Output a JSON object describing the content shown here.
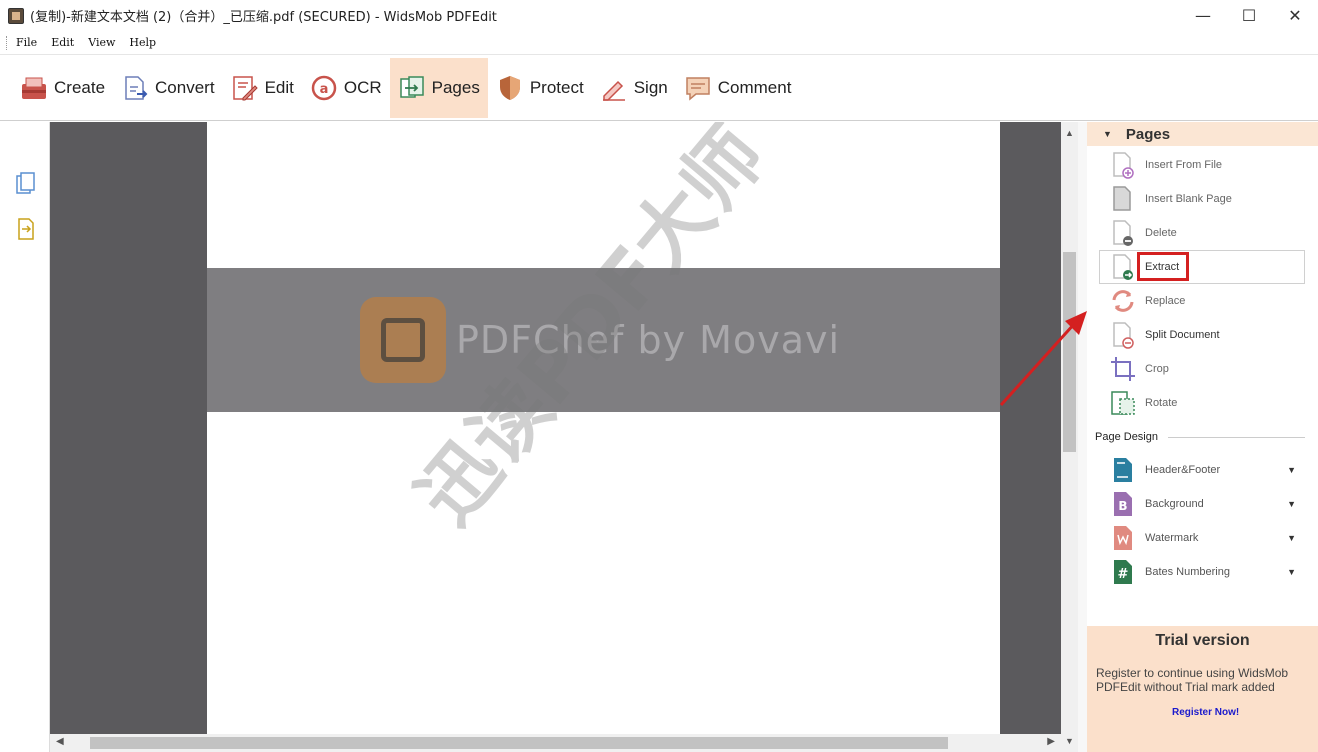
{
  "window": {
    "title": "(复制)-新建文本文档 (2)（合并）_已压缩.pdf (SECURED) - WidsMob PDFEdit",
    "controls": {
      "minimize": "—",
      "maximize": "☐",
      "close": "✕"
    }
  },
  "menu": [
    {
      "label": "File"
    },
    {
      "label": "Edit"
    },
    {
      "label": "View"
    },
    {
      "label": "Help"
    }
  ],
  "toolbar": {
    "buttons": [
      {
        "label": "Create",
        "icon": "create-icon"
      },
      {
        "label": "Convert",
        "icon": "convert-icon"
      },
      {
        "label": "Edit",
        "icon": "edit-icon"
      },
      {
        "label": "OCR",
        "icon": "ocr-icon"
      },
      {
        "label": "Pages",
        "icon": "pages-icon",
        "active": true
      },
      {
        "label": "Protect",
        "icon": "shield-icon"
      },
      {
        "label": "Sign",
        "icon": "pen-icon"
      },
      {
        "label": "Comment",
        "icon": "comment-icon"
      }
    ]
  },
  "document": {
    "brand_text": "PDFChef by Movavi",
    "watermark_text": "迅读PDF大师"
  },
  "pages_panel": {
    "title": "Pages",
    "items": [
      {
        "label": "Insert From File",
        "icon": "insert-file-icon"
      },
      {
        "label": "Insert Blank Page",
        "icon": "blank-page-icon"
      },
      {
        "label": "Delete",
        "icon": "delete-page-icon"
      },
      {
        "label": "Extract",
        "icon": "extract-page-icon",
        "selected": true
      },
      {
        "label": "Replace",
        "icon": "replace-icon"
      },
      {
        "label": "Split Document",
        "icon": "split-icon"
      },
      {
        "label": "Crop",
        "icon": "crop-icon"
      },
      {
        "label": "Rotate",
        "icon": "rotate-icon"
      }
    ],
    "design_title": "Page Design",
    "design_items": [
      {
        "label": "Header&Footer",
        "icon": "header-footer-icon"
      },
      {
        "label": "Background",
        "icon": "background-icon"
      },
      {
        "label": "Watermark",
        "icon": "watermark-icon"
      },
      {
        "label": "Bates Numbering",
        "icon": "bates-icon"
      }
    ]
  },
  "trial": {
    "title": "Trial version",
    "message": "Register to continue using WidsMob PDFEdit without Trial mark added",
    "link": "Register Now!"
  },
  "colors": {
    "accent": "#fbe0cb",
    "canvas": "#5b5a5d",
    "highlight": "#d42020"
  }
}
